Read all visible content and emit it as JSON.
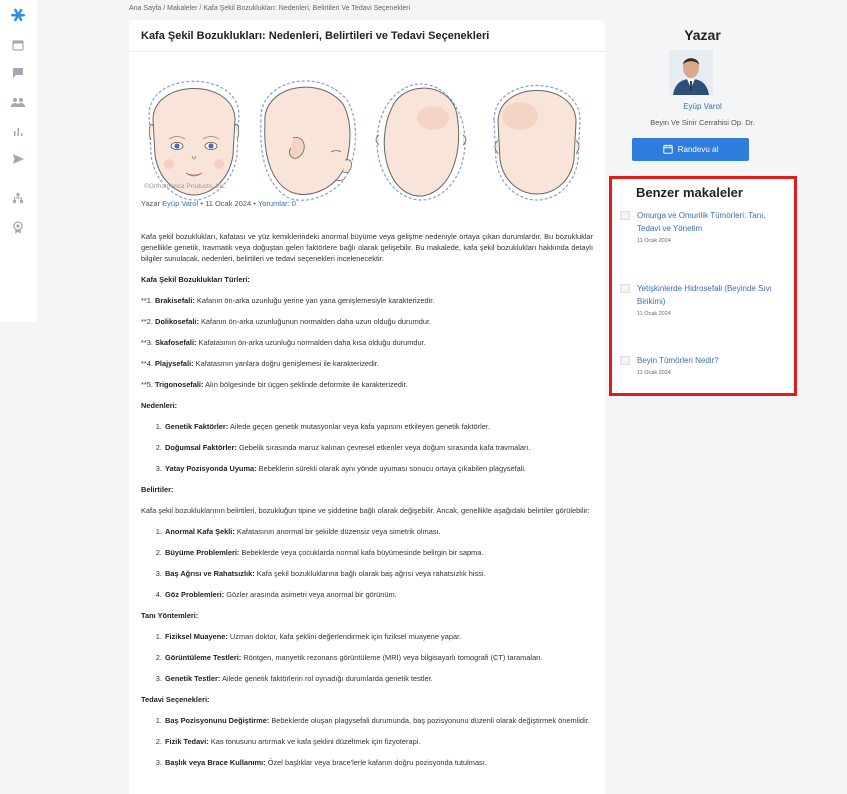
{
  "sidebar": {
    "icons": [
      "app-logo",
      "calendar-icon",
      "chat-icon",
      "users-icon",
      "chart-icon",
      "send-icon",
      "hierarchy-icon",
      "award-icon"
    ]
  },
  "breadcrumb": {
    "text": "Ana Sayfa / Makaleler / Kafa Şekil Bozuklukları: Nedenleri, Belirtileri Ve Tedavi Seçenekleri"
  },
  "article": {
    "title": "Kafa Şekil Bozuklukları: Nedenleri, Belirtileri ve Tedavi Seçenekleri",
    "image_credit": "©Orthomerica Products, Inc.",
    "meta": {
      "author_prefix": "Yazar",
      "author": "Eyüp Varol",
      "date": "• 11 Ocak 2024 •",
      "comments": "Yorumlar: 0"
    },
    "intro": "Kafa şekil bozuklukları, kafatası ve yüz kemiklerindeki anormal büyüme veya gelişme nedeniyle ortaya çıkan durumlardır. Bu bozukluklar genellikle genetik, travmatik veya doğuştan gelen faktörlere bağlı olarak gelişebilir. Bu makalede, kafa şekil bozuklukları hakkında detaylı bilgiler sunulacak, nedenleri, belirtileri ve tedavi seçenekleri incelenecektir.",
    "types_heading": "Kafa Şekil Bozuklukları Türleri:",
    "types": [
      {
        "prefix": "**1.",
        "term": "Brakisefali:",
        "desc": "Kafanın ön-arka uzunluğu yerine yan yana genişlemesiyle karakterizedir."
      },
      {
        "prefix": "**2.",
        "term": "Dolikosefali:",
        "desc": "Kafanın ön-arka uzunluğunun normalden daha uzun olduğu durumdur."
      },
      {
        "prefix": "**3.",
        "term": "Skafosefali:",
        "desc": "Kafatasının ön-arka uzunluğu normalden daha kısa olduğu durumdur."
      },
      {
        "prefix": "**4.",
        "term": "Plajysefali:",
        "desc": "Kafatasının yanlara doğru genişlemesi ile karakterizedir."
      },
      {
        "prefix": "**5.",
        "term": "Trigonosefali:",
        "desc": "Alın bölgesinde bir üçgen şeklinde deformite ile karakterizedir."
      }
    ],
    "causes_heading": "Nedenleri:",
    "causes": [
      {
        "term": "Genetik Faktörler:",
        "desc": "Ailede geçen genetik mutasyonlar veya kafa yapısını etkileyen genetik faktörler."
      },
      {
        "term": "Doğumsal Faktörler:",
        "desc": "Gebelik sırasında maruz kalınan çevresel etkenler veya doğum sırasında kafa travmaları."
      },
      {
        "term": "Yatay Pozisyonda Uyuma:",
        "desc": "Bebeklerin sürekli olarak aynı yönde uyuması sonucu ortaya çıkabilen plagysefali."
      }
    ],
    "symptoms_heading": "Belirtiler:",
    "symptoms_intro": "Kafa şekil bozukluklarının belirtileri, bozukluğun tipine ve şiddetine bağlı olarak değişebilir. Ancak, genellikle aşağıdaki belirtiler görülebilir:",
    "symptoms": [
      {
        "term": "Anormal Kafa Şekli:",
        "desc": "Kafatasının anormal bir şekilde düzensiz veya simetrik olması."
      },
      {
        "term": "Büyüme Problemleri:",
        "desc": "Bebeklerde veya çocuklarda normal kafa büyümesinde belirgin bir sapma."
      },
      {
        "term": "Baş Ağrısı ve Rahatsızlık:",
        "desc": "Kafa şekil bozukluklarına bağlı olarak baş ağrısı veya rahatsızlık hissi."
      },
      {
        "term": "Göz Problemleri:",
        "desc": "Gözler arasında asimetri veya anormal bir görünüm."
      }
    ],
    "diagnosis_heading": "Tanı Yöntemleri:",
    "diagnosis": [
      {
        "term": "Fiziksel Muayene:",
        "desc": "Uzman doktor, kafa şeklini değerlendirmek için fiziksel muayene yapar."
      },
      {
        "term": "Görüntüleme Testleri:",
        "desc": "Röntgen, manyetik rezonans görüntüleme (MRI) veya bilgisayarlı tomografi (CT) taramaları."
      },
      {
        "term": "Genetik Testler:",
        "desc": "Ailede genetik faktörlerin rol oynadığı durumlarda genetik testler."
      }
    ],
    "treatment_heading": "Tedavi Seçenekleri:",
    "treatment": [
      {
        "term": "Baş Pozisyonunu Değiştirme:",
        "desc": "Bebeklerde oluşan plagysefali durumunda, baş pozisyonunu düzenli olarak değiştirmek önemlidir."
      },
      {
        "term": "Fizik Tedavi:",
        "desc": "Kas tonusunu artırmak ve kafa şeklini düzeltmek için fizyoterapi."
      },
      {
        "term": "Başlık veya Brace Kullanımı:",
        "desc": "Özel başlıklar veya brace'lerle kafanın doğru pozisyonda tutulması."
      }
    ]
  },
  "author": {
    "heading": "Yazar",
    "name": "Eyüp Varol",
    "title": "Beyin Ve Sinir Cerrahisi Op. Dr.",
    "button_label": "Randevu al"
  },
  "related": {
    "heading": "Benzer makaleler",
    "items": [
      {
        "title": "Omurga ve Omurilik Tümörleri: Tanı, Tedavi ve Yönetim",
        "date": "11 Ocak 2024"
      },
      {
        "title": "Yetişkinlerde Hidrosefali (Beyinde Sıvı Birikimi)",
        "date": "11 Ocak 2024"
      },
      {
        "title": "Beyin Tümörleri Nedir?",
        "date": "11 Ocak 2024"
      }
    ]
  },
  "colors": {
    "accent": "#2f7ddc",
    "link": "#3b6fb3",
    "highlight_border": "#e01c1c",
    "background": "#f4f5f7"
  }
}
